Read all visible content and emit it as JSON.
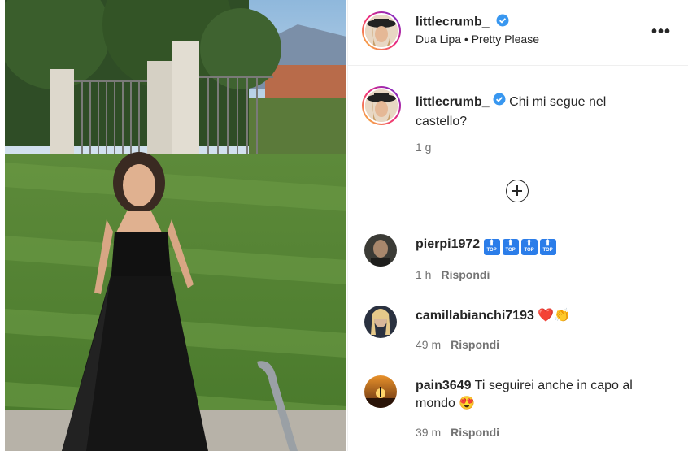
{
  "post": {
    "author": "littlecrumb_",
    "audio": "Dua Lipa • Pretty Please",
    "caption": "Chi mi segue nel castello?",
    "caption_age": "1 g",
    "more_label": "•••"
  },
  "comments": [
    {
      "user": "pierpi1972",
      "text": "",
      "emoji": [
        "top-icon",
        "top-icon",
        "top-icon",
        "top-icon"
      ],
      "age": "1 h",
      "reply": "Rispondi"
    },
    {
      "user": "camillabianchi7193",
      "text": "❤️👏",
      "age": "49 m",
      "reply": "Rispondi"
    },
    {
      "user": "pain3649",
      "text": "Ti seguirei anche in capo al mondo 😍",
      "age": "39 m",
      "reply": "Rispondi"
    }
  ],
  "colors": {
    "verified": "#3897f0",
    "muted": "#737373",
    "border": "#efefef"
  }
}
